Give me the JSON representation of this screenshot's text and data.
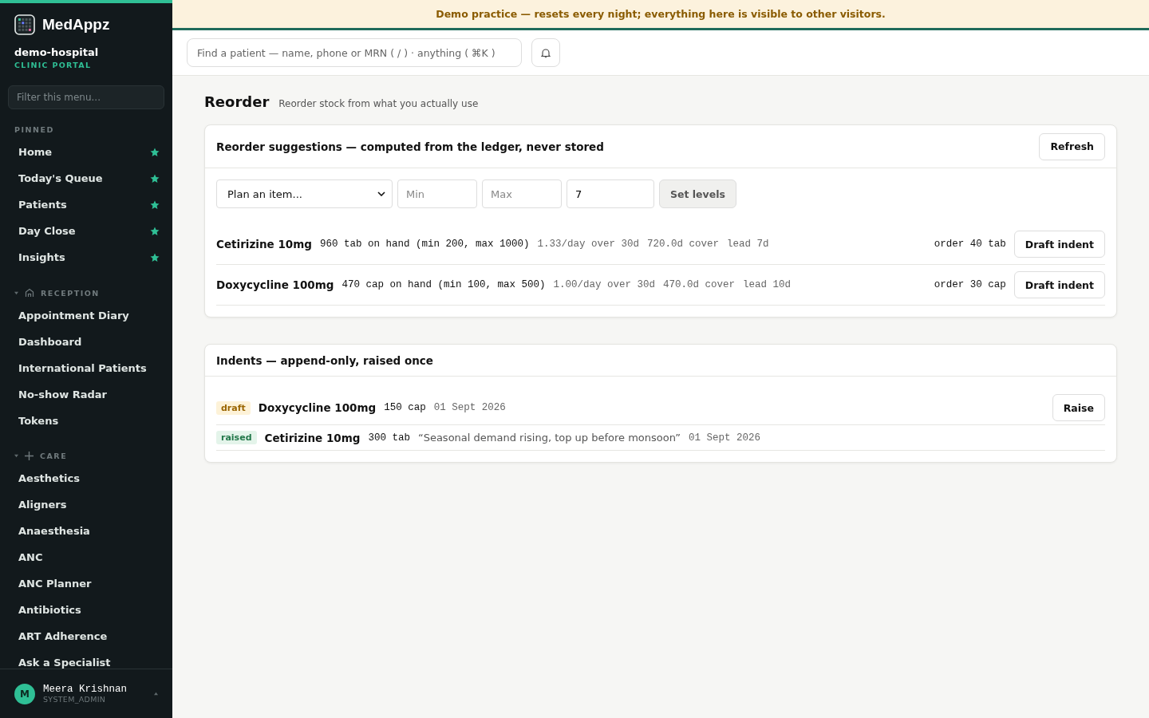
{
  "sidebar": {
    "brand": "MedAppz",
    "org": "demo-hospital",
    "org_subtitle": "CLINIC PORTAL",
    "filter_placeholder": "Filter this menu...",
    "pinned": {
      "title": "PINNED",
      "items": [
        {
          "label": "Home",
          "starred": true
        },
        {
          "label": "Today's Queue",
          "starred": true
        },
        {
          "label": "Patients",
          "starred": true
        },
        {
          "label": "Day Close",
          "starred": true
        },
        {
          "label": "Insights",
          "starred": true
        }
      ]
    },
    "sections": [
      {
        "title": "RECEPTION",
        "kind": "house",
        "expanded": true,
        "items": [
          "Appointment Diary",
          "Dashboard",
          "International Patients",
          "No-show Radar",
          "Tokens"
        ]
      },
      {
        "title": "CARE",
        "kind": "plus",
        "expanded": true,
        "items": [
          "Aesthetics",
          "Aligners",
          "Anaesthesia",
          "ANC",
          "ANC Planner",
          "Antibiotics",
          "ART Adherence",
          "Ask a Specialist"
        ]
      }
    ],
    "user": {
      "initial": "M",
      "name": "Meera Krishnan",
      "role": "SYSTEM_ADMIN"
    }
  },
  "banner": "Demo practice — resets every night; everything here is visible to other visitors.",
  "search": {
    "placeholder": "Find a patient — name, phone or MRN ( / ) · anything ( ⌘K )"
  },
  "page": {
    "title": "Reorder",
    "subtitle": "Reorder stock from what you actually use"
  },
  "suggestions": {
    "title": "Reorder suggestions — computed from the ledger, never stored",
    "refresh": "Refresh",
    "form": {
      "item_placeholder": "Plan an item...",
      "min_placeholder": "Min",
      "max_placeholder": "Max",
      "lead_value": "7",
      "submit": "Set levels"
    },
    "rows": [
      {
        "name": "Cetirizine 10mg",
        "stock": "960 tab on hand (min 200, max 1000)",
        "usage": "1.33/day over 30d",
        "cover": "720.0d cover",
        "lead": "lead 7d",
        "order": "order 40 tab",
        "action": "Draft indent"
      },
      {
        "name": "Doxycycline 100mg",
        "stock": "470 cap on hand (min 100, max 500)",
        "usage": "1.00/day over 30d",
        "cover": "470.0d cover",
        "lead": "lead 10d",
        "order": "order 30 cap",
        "action": "Draft indent"
      }
    ]
  },
  "indents": {
    "title": "Indents — append-only, raised once",
    "rows": [
      {
        "status": "draft",
        "name": "Doxycycline 100mg",
        "qty": "150 cap",
        "date": "01 Sept 2026",
        "action": "Raise"
      },
      {
        "status": "raised",
        "name": "Cetirizine 10mg",
        "qty": "300 tab",
        "note": "“Seasonal demand rising, top up before monsoon”",
        "date": "01 Sept 2026"
      }
    ]
  }
}
